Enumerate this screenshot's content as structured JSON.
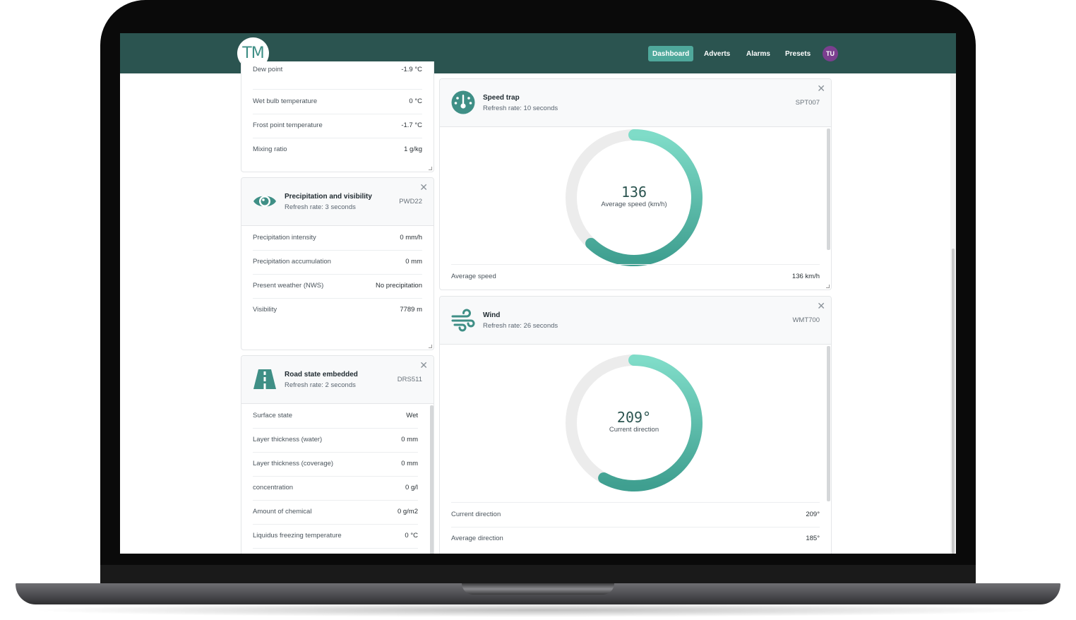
{
  "topbar": {
    "logo_text": "TM",
    "nav": [
      "Dashboard",
      "Adverts",
      "Alarms",
      "Presets"
    ],
    "active_nav": "Dashboard",
    "avatar_initials": "TU",
    "brand_color": "#2b5450",
    "accent_color": "#4fa89b"
  },
  "humidity_card": {
    "rows": [
      {
        "label": "Dew point",
        "value": "-1.9 °C"
      },
      {
        "label": "Wet bulb temperature",
        "value": "0 °C"
      },
      {
        "label": "Frost point temperature",
        "value": "-1.7 °C"
      },
      {
        "label": "Mixing ratio",
        "value": "1 g/kg"
      }
    ]
  },
  "precip_card": {
    "icon": "eye-icon",
    "title": "Precipitation and visibility",
    "refresh": "Refresh rate: 3 seconds",
    "code": "PWD22",
    "rows": [
      {
        "label": "Precipitation intensity",
        "value": "0 mm/h"
      },
      {
        "label": "Precipitation accumulation",
        "value": "0 mm"
      },
      {
        "label": "Present weather (NWS)",
        "value": "No precipitation"
      },
      {
        "label": "Visibility",
        "value": "7789 m"
      }
    ]
  },
  "road_card": {
    "icon": "road-icon",
    "title": "Road state embedded",
    "refresh": "Refresh rate: 2 seconds",
    "code": "DRS511",
    "rows": [
      {
        "label": "Surface state",
        "value": "Wet"
      },
      {
        "label": "Layer thickness (water)",
        "value": "0 mm"
      },
      {
        "label": "Layer thickness (coverage)",
        "value": "0 mm"
      },
      {
        "label": "concentration",
        "value": "0 g/l"
      },
      {
        "label": "Amount of chemical",
        "value": "0 g/m2"
      },
      {
        "label": "Liquidus freezing temperature",
        "value": "0 °C"
      }
    ]
  },
  "speed_card": {
    "icon": "speedometer-icon",
    "title": "Speed trap",
    "refresh": "Refresh rate: 10 seconds",
    "code": "SPT007",
    "gauge_value": "136",
    "gauge_label": "Average speed (km/h)",
    "gauge_fraction": 0.62,
    "rows": [
      {
        "label": "Average speed",
        "value": "136 km/h"
      }
    ]
  },
  "wind_card": {
    "icon": "wind-icon",
    "title": "Wind",
    "refresh": "Refresh rate: 26 seconds",
    "code": "WMT700",
    "gauge_value": "209°",
    "gauge_label": "Current direction",
    "gauge_fraction": 0.58,
    "rows": [
      {
        "label": "Current direction",
        "value": "209°"
      },
      {
        "label": "Average direction",
        "value": "185°"
      }
    ]
  }
}
